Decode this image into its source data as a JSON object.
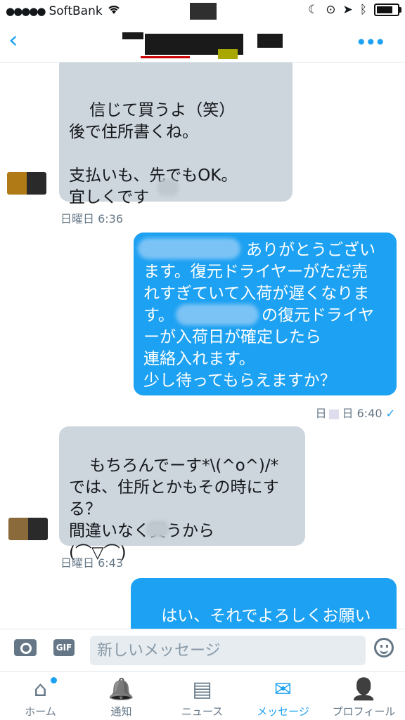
{
  "status_bar": {
    "carrier": "SoftBank",
    "signal_dots": "●●●●●"
  },
  "header": {
    "back_icon": "‹",
    "more_icon": "•••"
  },
  "messages": [
    {
      "from": "them",
      "text": "信じて買うよ（笑）\n後で住所書くね。\n\n支払いも、先でもOK。\n宜しくです",
      "time": "日曜日 6:36"
    },
    {
      "from": "me",
      "text_line1": "ありがとうござい",
      "text_rest": "ます。復元ドライヤーがただ売\nれすぎていて入荷が遅くなりま\nす。",
      "text_after_blur": "の復元ドライヤ",
      "text_end": "ーが入荷日が確定したら\n連絡入れます。\n少し待ってもらえますか？",
      "time": "6:40",
      "time_prefix": "日",
      "time_suffix": "日",
      "read": "✓"
    },
    {
      "from": "them",
      "text": "もちろんでーす*\\(^o^)/*\nでは、住所とかもその時にす\nる？\n間違いなく買うから\n(⌒▽⌒)",
      "time": "日曜日 6:43"
    },
    {
      "from": "me",
      "text": "はい、それでよろしくお願いし\nます。ありがとうねー＼(^o^)／"
    }
  ],
  "composer": {
    "placeholder": "新しいメッセージ",
    "gif_label": "GIF"
  },
  "tabs": [
    {
      "label": "ホーム",
      "icon": "⌂"
    },
    {
      "label": "通知",
      "icon": "🔔"
    },
    {
      "label": "ニュース",
      "icon": "▤"
    },
    {
      "label": "メッセージ",
      "icon": "✉",
      "active": true
    },
    {
      "label": "プロフィール",
      "icon": "👤"
    }
  ],
  "colors": {
    "accent": "#1da1f2",
    "received_bubble": "#cdd5dd"
  }
}
